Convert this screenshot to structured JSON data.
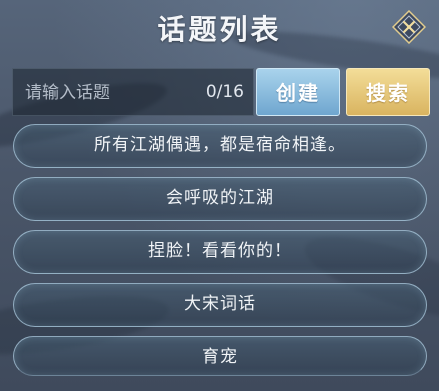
{
  "header": {
    "title": "话题列表",
    "close_icon": "close-diamond-icon"
  },
  "search": {
    "placeholder": "请输入话题",
    "value": "",
    "char_count": "0/16",
    "create_label": "创建",
    "search_label": "搜索"
  },
  "topics": [
    {
      "label": "所有江湖偶遇，都是宿命相逢。"
    },
    {
      "label": "会呼吸的江湖"
    },
    {
      "label": "捏脸！看看你的！"
    },
    {
      "label": "大宋词话"
    },
    {
      "label": "育宠"
    }
  ],
  "colors": {
    "create_button": "#8bbfe0",
    "search_button": "#e6c578",
    "panel_background": "#4d5a6e"
  }
}
